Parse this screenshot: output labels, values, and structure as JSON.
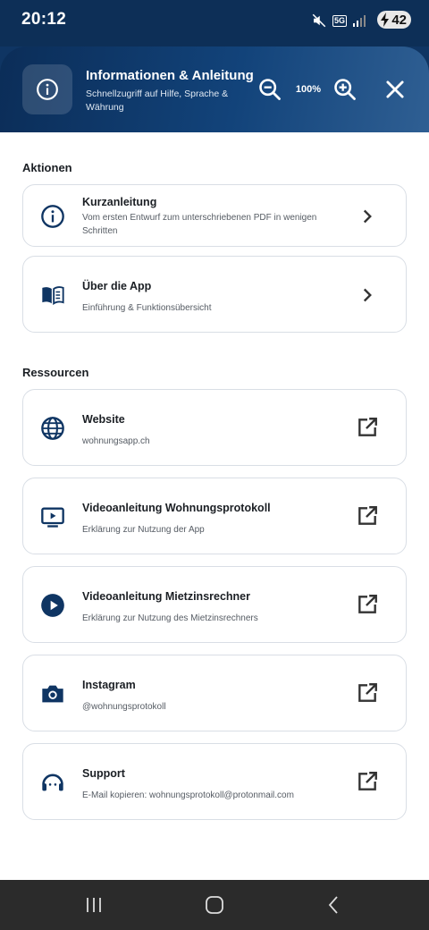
{
  "status_bar": {
    "time": "20:12",
    "network": "5G",
    "battery": "42"
  },
  "header": {
    "title": "Informationen & Anleitung",
    "subtitle": "Schnellzugriff auf Hilfe, Sprache & Währung",
    "zoom_level": "100%",
    "icons": [
      "info-icon",
      "zoom-out-icon",
      "zoom-in-icon",
      "close-icon"
    ]
  },
  "sections": {
    "actions_title": "Aktionen",
    "resources_title": "Ressourcen"
  },
  "actions": [
    {
      "title": "Kurzanleitung",
      "subtitle": "Vom ersten Entwurf zum unterschriebenen PDF in wenigen Schritten",
      "icon": "info-icon"
    },
    {
      "title": "Über die App",
      "subtitle": "Einführung & Funktionsübersicht",
      "icon": "book-icon"
    }
  ],
  "resources": [
    {
      "title": "Website",
      "subtitle": "wohnungsapp.ch",
      "icon": "globe-icon"
    },
    {
      "title": "Videoanleitung Wohnungsprotokoll",
      "subtitle": "Erklärung zur Nutzung der App",
      "icon": "video-screen-icon"
    },
    {
      "title": "Videoanleitung Mietzinsrechner",
      "subtitle": "Erklärung zur Nutzung des Mietzinsrechners",
      "icon": "play-circle-icon"
    },
    {
      "title": "Instagram",
      "subtitle": "@wohnungsprotokoll",
      "icon": "camera-icon"
    },
    {
      "title": "Support",
      "subtitle": "E-Mail kopieren: wohnungsprotokoll@protonmail.com",
      "icon": "headset-icon"
    }
  ],
  "colors": {
    "accent": "#0f3563",
    "header_gradient_end": "#2f5f93",
    "card_border": "#d9dee5"
  }
}
